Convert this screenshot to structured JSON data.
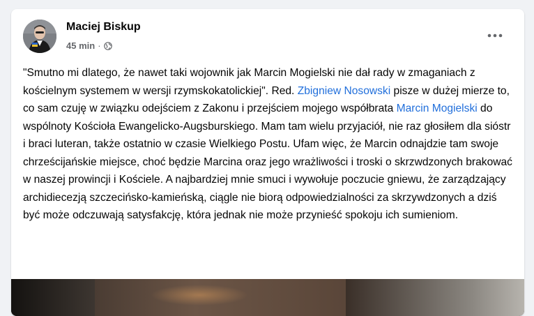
{
  "post": {
    "author": "Maciej Biskup",
    "time": "45 min",
    "separator": "·",
    "privacy_icon": "globe-icon",
    "more_icon": "more-options-icon",
    "text": {
      "p1": "\"Smutno mi dlatego, że nawet taki wojownik jak Marcin Mogielski nie dał rady w zmaganiach z kościelnym systemem w wersji rzymskokatolickiej\". Red. ",
      "link1": "Zbigniew Nosowski",
      "p2": " pisze w dużej mierze to, co sam czuję w związku odejściem z Zakonu i przejściem mojego współbrata ",
      "link2": "Marcin Mogielski",
      "p3": " do wspólnoty Kościoła Ewangelicko-Augsburskiego. Mam tam wielu przyjaciół, nie raz głosiłem dla sióstr i braci luteran, także ostatnio w czasie Wielkiego Postu. Ufam więc, że Marcin odnajdzie tam swoje chrześcijańskie miejsce, choć będzie Marcina oraz jego wrażliwości i troski o skrzwdzonych brakować w naszej prowincji i Kościele. A najbardziej mnie smuci i wywołuje poczucie gniewu, że zarządzający archidiecezją szczecińsko-kamieńską, ciągle nie biorą odpowiedzialności za skrzywdzonych a dziś być może odczuwają satysfakcję, która jednak nie może przynieść spokoju ich sumieniom."
    }
  },
  "colors": {
    "link": "#216fdb",
    "text": "#050505",
    "meta": "#65676b",
    "background": "#f0f2f5",
    "card": "#ffffff"
  }
}
